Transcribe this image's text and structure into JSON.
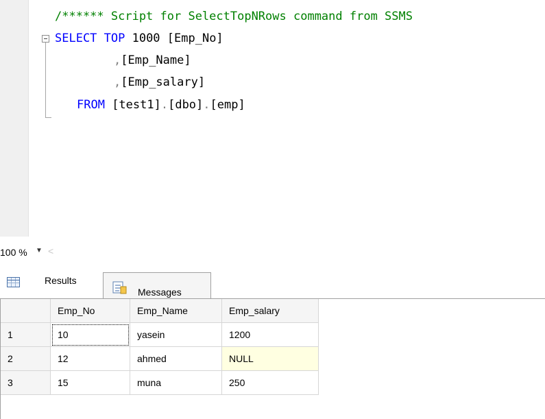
{
  "editor": {
    "lines": [
      {
        "parts": [
          {
            "t": "/****** Script for SelectTopNRows command from SSMS",
            "c": "cm"
          }
        ]
      },
      {
        "parts": [
          {
            "t": "SELECT TOP ",
            "c": "kw"
          },
          {
            "t": "1000 ",
            "c": "tx"
          },
          {
            "t": "[Emp_No]",
            "c": "tx"
          }
        ]
      },
      {
        "parts": [
          {
            "t": ",",
            "c": "gr"
          },
          {
            "t": "[Emp_Name]",
            "c": "tx"
          }
        ]
      },
      {
        "parts": [
          {
            "t": ",",
            "c": "gr"
          },
          {
            "t": "[Emp_salary]",
            "c": "tx"
          }
        ]
      },
      {
        "parts": [
          {
            "t": "FROM ",
            "c": "kw"
          },
          {
            "t": "[test1]",
            "c": "tx"
          },
          {
            "t": ".",
            "c": "gr"
          },
          {
            "t": "[dbo]",
            "c": "tx"
          },
          {
            "t": ".",
            "c": "gr"
          },
          {
            "t": "[emp]",
            "c": "tx"
          }
        ]
      }
    ]
  },
  "zoom": {
    "value": "100 %",
    "dropdown_icon": "chevron-down-icon",
    "scroll_icon": "scroll-left-icon"
  },
  "tabs": {
    "results": {
      "label": "Results",
      "icon": "grid-icon"
    },
    "messages": {
      "label": "Messages",
      "icon": "messages-icon"
    }
  },
  "grid": {
    "columns": [
      "Emp_No",
      "Emp_Name",
      "Emp_salary"
    ],
    "rows": [
      {
        "num": "1",
        "cells": [
          "10",
          "yasein",
          "1200"
        ]
      },
      {
        "num": "2",
        "cells": [
          "12",
          "ahmed",
          "NULL"
        ]
      },
      {
        "num": "3",
        "cells": [
          "15",
          "muna",
          "250"
        ]
      }
    ],
    "colors": {
      "null_highlight": "#ffffe1",
      "header_bg": "#f5f5f5"
    }
  },
  "colors": {
    "keyword": "#0000ff",
    "comment": "#008000",
    "operator": "#808080"
  }
}
